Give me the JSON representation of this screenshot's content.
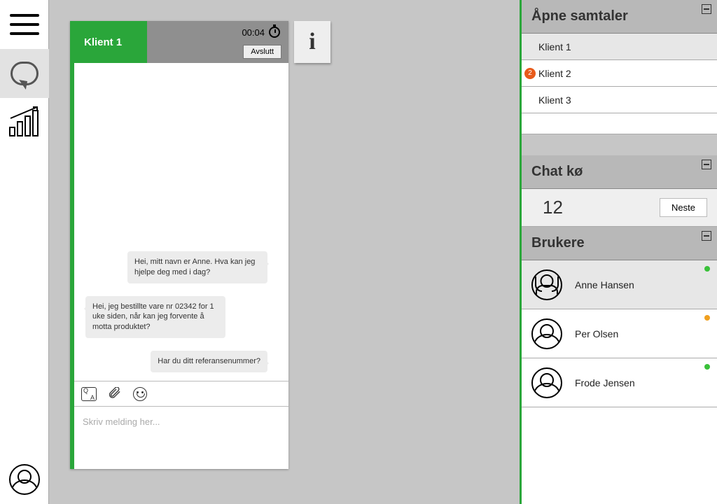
{
  "chat": {
    "client_label": "Klient 1",
    "timer": "00:04",
    "end_label": "Avslutt",
    "info_label": "i",
    "messages": [
      {
        "side": "agent",
        "text": "Hei, mitt navn er Anne. Hva kan jeg hjelpe deg med i dag?"
      },
      {
        "side": "client",
        "text": "Hei, jeg bestillte vare nr 02342 for 1 uke siden, når kan jeg forvente å motta produktet?"
      },
      {
        "side": "agent",
        "text": "Har du ditt referansenummer?"
      }
    ],
    "compose_placeholder": "Skriv melding her..."
  },
  "right": {
    "open_title": "Åpne samtaler",
    "open_items": [
      {
        "label": "Klient 1",
        "selected": true,
        "badge": null
      },
      {
        "label": "Klient 2",
        "selected": false,
        "badge": "2"
      },
      {
        "label": "Klient 3",
        "selected": false,
        "badge": null
      }
    ],
    "queue_title": "Chat kø",
    "queue_count": "12",
    "queue_next": "Neste",
    "users_title": "Brukere",
    "users": [
      {
        "name": "Anne Hansen",
        "status": "green",
        "selected": true,
        "avatar": "female"
      },
      {
        "name": "Per Olsen",
        "status": "orange",
        "selected": false,
        "avatar": "male"
      },
      {
        "name": "Frode Jensen",
        "status": "green",
        "selected": false,
        "avatar": "male"
      }
    ]
  }
}
